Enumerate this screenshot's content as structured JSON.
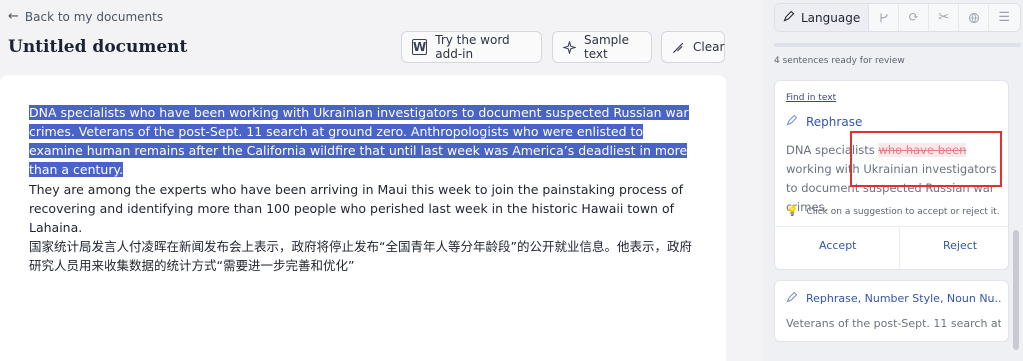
{
  "nav": {
    "back_label": "Back to my documents"
  },
  "document": {
    "title": "Untitled document"
  },
  "toolbar": {
    "word_addin_label": "Try the word add-in",
    "sample_text_label": "Sample text",
    "clear_label": "Clear"
  },
  "editor": {
    "paragraph1": "DNA specialists who have been working with Ukrainian investigators to document suspected Russian war crimes. Veterans of the post-Sept. 11 search at ground zero. Anthropologists who were enlisted to examine human remains after the California wildfire that until last week was America’s deadliest in more than a century.",
    "paragraph2_line1": "They are among the experts who have been arriving in Maui this week to join the painstaking process of recovering and identifying more than 100 people who perished last week in the historic Hawaii town of Lahaina.",
    "paragraph2_line2": "国家统计局发言人付凌晖在新闻发布会上表示，政府将停止发布“全国青年人等分年龄段”的公开就业信息。他表示，政府研究人员用来收集数据的统计方式“需要进一步完善和优化”"
  },
  "panel": {
    "language_tab_label": "Language",
    "tabs": [
      "branch-icon",
      "refresh-icon",
      "scissors-icon",
      "globe-icon",
      "list-icon"
    ],
    "ready_text": "4 sentences ready for review",
    "card1": {
      "find_link": "Find in text",
      "type": "Rephrase",
      "text_before": "DNA specialists ",
      "text_deleted": "who have been",
      "text_after": " working with Ukrainian investigators to document suspected Russian war crimes.",
      "hint": "Click on a suggestion to accept or reject it.",
      "accept_label": "Accept",
      "reject_label": "Reject"
    },
    "card2": {
      "title": "Rephrase, Number Style, Noun Nu...",
      "preview": "Veterans of the post-Sept. 11 search at ..."
    }
  },
  "colors": {
    "selection": "#4a63c8",
    "accent": "#3553b0",
    "annotation_box": "#e2302e"
  }
}
